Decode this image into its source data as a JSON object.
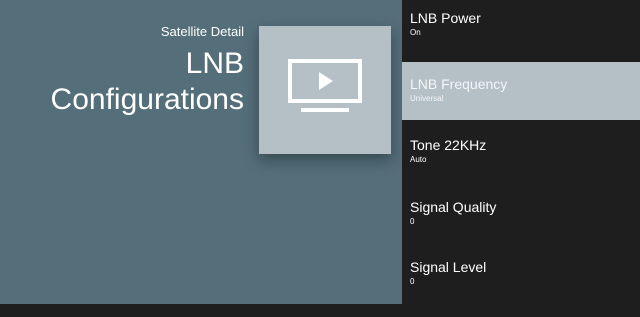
{
  "header": {
    "breadcrumb": "Satellite Detail",
    "title_line1": "LNB",
    "title_line2": "Configurations"
  },
  "tile": {
    "icon": "tv-play-icon"
  },
  "menu": {
    "items": [
      {
        "label": "LNB Power",
        "value": "On",
        "selected": false
      },
      {
        "label": "LNB Frequency",
        "value": "Universal",
        "selected": true
      },
      {
        "label": "Tone 22KHz",
        "value": "Auto",
        "selected": false
      },
      {
        "label": "Signal Quality",
        "value": "0",
        "selected": false
      },
      {
        "label": "Signal Level",
        "value": "0",
        "selected": false
      }
    ]
  },
  "colors": {
    "left_background": "#546e7a",
    "right_background": "#1e1e1e",
    "tile_background": "#b4bfc6",
    "selected_background": "#b4bfc6",
    "text": "#ffffff"
  }
}
